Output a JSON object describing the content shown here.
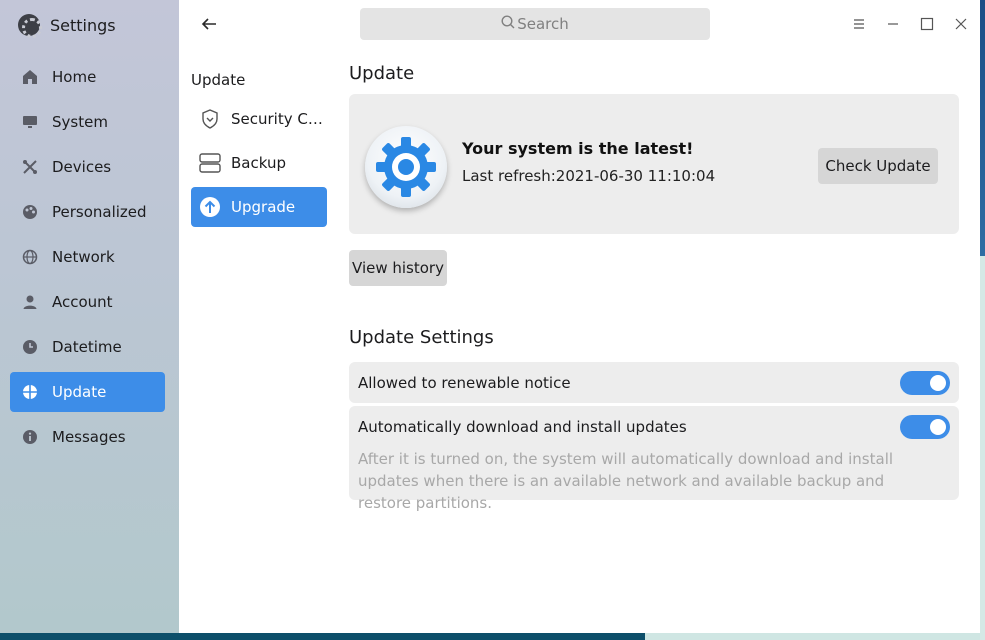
{
  "app": {
    "title": "Settings"
  },
  "sidebar": {
    "items": [
      {
        "label": "Home",
        "icon": "home-icon"
      },
      {
        "label": "System",
        "icon": "monitor-icon"
      },
      {
        "label": "Devices",
        "icon": "devices-icon"
      },
      {
        "label": "Personalized",
        "icon": "palette-icon"
      },
      {
        "label": "Network",
        "icon": "globe-icon"
      },
      {
        "label": "Account",
        "icon": "user-icon"
      },
      {
        "label": "Datetime",
        "icon": "clock-icon"
      },
      {
        "label": "Update",
        "icon": "update-icon",
        "active": true
      },
      {
        "label": "Messages",
        "icon": "info-icon"
      }
    ]
  },
  "search": {
    "placeholder": "Search"
  },
  "subnav": {
    "title": "Update",
    "items": [
      {
        "label": "Security Center",
        "icon": "shield-icon"
      },
      {
        "label": "Backup",
        "icon": "backup-icon"
      },
      {
        "label": "Upgrade",
        "icon": "upgrade-icon",
        "active": true
      }
    ]
  },
  "update": {
    "heading": "Update",
    "status_title": "Your system is the latest!",
    "last_refresh": "Last refresh:2021-06-30 11:10:04",
    "check_label": "Check Update",
    "history_label": "View history"
  },
  "settings": {
    "heading": "Update Settings",
    "renewable_notice": {
      "label": "Allowed to renewable notice",
      "enabled": true
    },
    "auto_update": {
      "label": "Automatically download and install updates",
      "description": "After it is turned on, the system will automatically download and install updates when there is an available network and available backup and restore partitions.",
      "enabled": true
    }
  },
  "colors": {
    "accent": "#3d8de8"
  }
}
